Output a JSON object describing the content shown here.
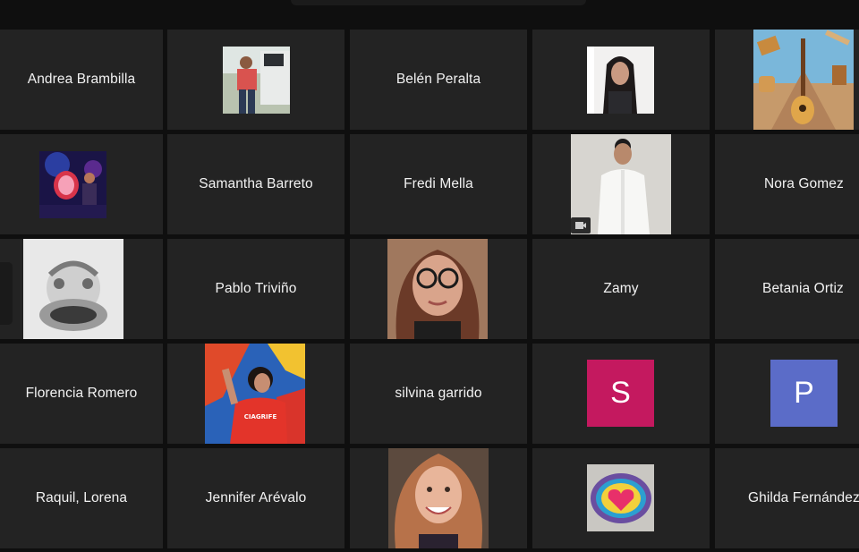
{
  "participants": [
    {
      "name": "Andrea Brambilla",
      "video": false
    },
    {
      "name": "",
      "video": true,
      "image": "man-outdoors-photo"
    },
    {
      "name": "Belén Peralta",
      "video": false
    },
    {
      "name": "",
      "video": true,
      "image": "woman-long-hair-photo"
    },
    {
      "name": "",
      "video": true,
      "image": "andean-instruments-art"
    },
    {
      "name": "",
      "video": true,
      "image": "concert-drummer-photo"
    },
    {
      "name": "Samantha Barreto",
      "video": false
    },
    {
      "name": "Fredi Mella",
      "video": false
    },
    {
      "name": "",
      "video": true,
      "image": "man-white-shirt-photo"
    },
    {
      "name": "Nora Gomez",
      "video": false
    },
    {
      "name": "",
      "video": true,
      "image": "bw-instrument-photo"
    },
    {
      "name": "Pablo Triviño",
      "video": false
    },
    {
      "name": "",
      "video": true,
      "image": "woman-glasses-photo"
    },
    {
      "name": "Zamy",
      "video": false
    },
    {
      "name": "Betania Ortiz",
      "video": false
    },
    {
      "name": "Florencia Romero",
      "video": false
    },
    {
      "name": "",
      "video": true,
      "image": "woman-graffiti-photo",
      "shirt_text": "CIAGRIFE"
    },
    {
      "name": "silvina garrido",
      "video": false
    },
    {
      "name": "",
      "avatar_letter": "S",
      "avatar_color": "#c4195f"
    },
    {
      "name": "",
      "avatar_letter": "P",
      "avatar_color": "#5b6cc8"
    },
    {
      "name": "Raquil, Lorena",
      "video": false
    },
    {
      "name": "Jennifer Arévalo",
      "video": false
    },
    {
      "name": "",
      "video": true,
      "image": "woman-smiling-photo"
    },
    {
      "name": "",
      "video": true,
      "image": "heart-painted-stone"
    },
    {
      "name": "Ghilda Fernández",
      "video": false
    }
  ],
  "colors": {
    "background": "#0f0f0f",
    "tile": "#232323",
    "text": "#f2f2f2"
  }
}
